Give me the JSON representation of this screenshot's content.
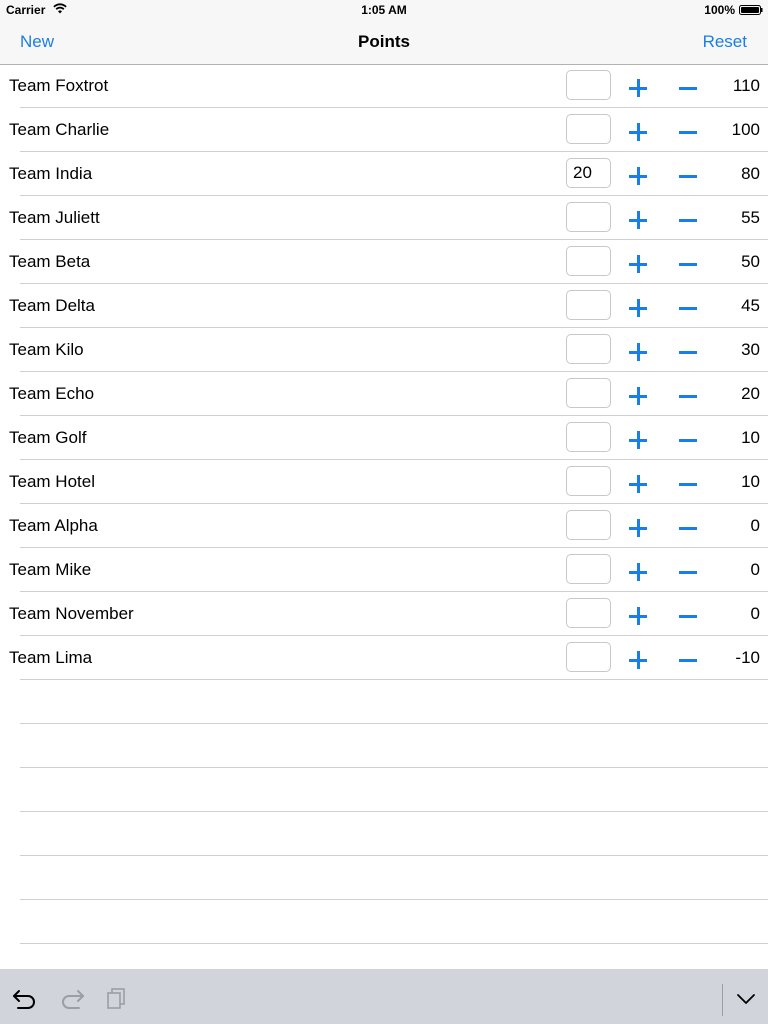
{
  "status_bar": {
    "carrier": "Carrier",
    "time": "1:05 AM",
    "battery": "100%"
  },
  "nav": {
    "left_button": "New",
    "title": "Points",
    "right_button": "Reset"
  },
  "colors": {
    "accent": "#1a7ee8",
    "separator": "#d0d0d4",
    "keyboard_bar": "#d1d5db"
  },
  "teams": [
    {
      "name": "Team Foxtrot",
      "input": "",
      "score": "110"
    },
    {
      "name": "Team Charlie",
      "input": "",
      "score": "100"
    },
    {
      "name": "Team India",
      "input": "20",
      "score": "80"
    },
    {
      "name": "Team Juliett",
      "input": "",
      "score": "55"
    },
    {
      "name": "Team Beta",
      "input": "",
      "score": "50"
    },
    {
      "name": "Team Delta",
      "input": "",
      "score": "45"
    },
    {
      "name": "Team Kilo",
      "input": "",
      "score": "30"
    },
    {
      "name": "Team Echo",
      "input": "",
      "score": "20"
    },
    {
      "name": "Team Golf",
      "input": "",
      "score": "10"
    },
    {
      "name": "Team Hotel",
      "input": "",
      "score": "10"
    },
    {
      "name": "Team Alpha",
      "input": "",
      "score": "0"
    },
    {
      "name": "Team Mike",
      "input": "",
      "score": "0"
    },
    {
      "name": "Team November",
      "input": "",
      "score": "0"
    },
    {
      "name": "Team Lima",
      "input": "",
      "score": "-10"
    }
  ],
  "icons": {
    "undo": "undo-icon",
    "redo": "redo-icon",
    "paste": "paste-icon",
    "dismiss_keyboard": "chevron-down-icon",
    "plus": "plus-icon",
    "minus": "minus-icon"
  }
}
